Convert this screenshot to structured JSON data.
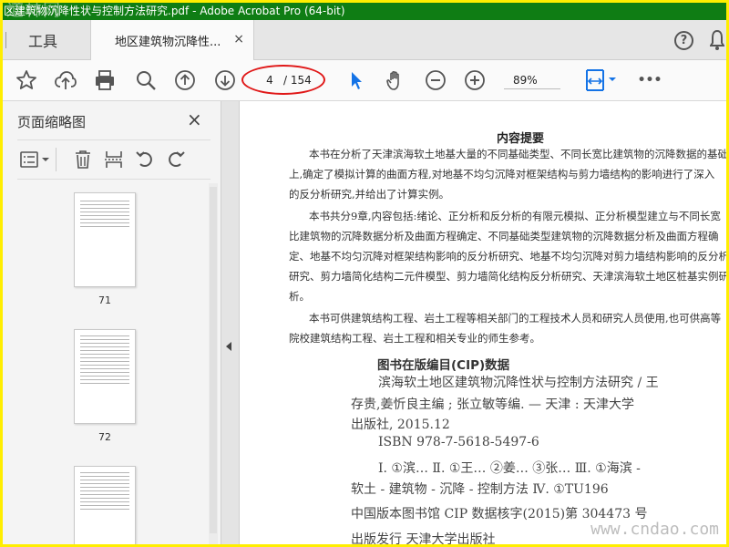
{
  "window": {
    "title": "区建筑物沉降性状与控制方法研究.pdf - Adobe Acrobat Pro (64-bit)",
    "watermark": "道林网"
  },
  "tabs": {
    "tools_label": "工具",
    "doc_tab_label": "地区建筑物沉降性...",
    "doc_tab_close": "×",
    "help_label": "?"
  },
  "toolbar": {
    "current_page": "4",
    "total_pages": "/ 154",
    "zoom": "89%",
    "more": "•••"
  },
  "left_panel": {
    "title": "页面缩略图",
    "close": "×",
    "thumbnails": [
      {
        "label": "71"
      },
      {
        "label": "72"
      }
    ]
  },
  "document": {
    "heading": "内容提要",
    "paragraphs": [
      "本书在分析了天津滨海软土地基大量的不同基础类型、不同长宽比建筑物的沉降数据的基础",
      "上,确定了模拟计算的曲面方程,对地基不均匀沉降对框架结构与剪力墙结构的影响进行了深入",
      "的反分析研究,并给出了计算实例。",
      "本书共分9章,内容包括:绪论、正分析和反分析的有限元模拟、正分析模型建立与不同长宽",
      "比建筑物的沉降数据分析及曲面方程确定、不同基础类型建筑物的沉降数据分析及曲面方程确",
      "定、地基不均匀沉降对框架结构影响的反分析研究、地基不均匀沉降对剪力墙结构影响的反分析",
      "研究、剪力墙简化结构二元件模型、剪力墙简化结构反分析研究、天津滨海软土地区桩基实例研究",
      "析。",
      "本书可供建筑结构工程、岩土工程等相关部门的工程技术人员和研究人员使用,也可供高等",
      "院校建筑结构工程、岩土工程和相关专业的师生参考。"
    ],
    "cip_heading": "图书在版编目(CIP)数据",
    "cip_lines": [
      "滨海软土地区建筑物沉降性状与控制方法研究 / 王",
      "存贵,姜忻良主编 ; 张立敏等编. — 天津 : 天津大学",
      "出版社, 2015.12",
      "ISBN 978-7-5618-5497-6",
      "Ⅰ. ①滨… Ⅱ. ①王… ②姜… ③张… Ⅲ. ①海滨 -",
      "软土 - 建筑物 - 沉降 - 控制方法 Ⅳ. ①TU196",
      "中国版本图书馆 CIP 数据核字(2015)第 304473 号",
      "出版发行 天津大学出版社"
    ],
    "watermark": "www.cndao.com"
  },
  "colors": {
    "title_bar": "#0f7d14",
    "frame_border": "#ffee00",
    "annotation_oval": "#e01818",
    "accent_blue": "#1473e6"
  }
}
